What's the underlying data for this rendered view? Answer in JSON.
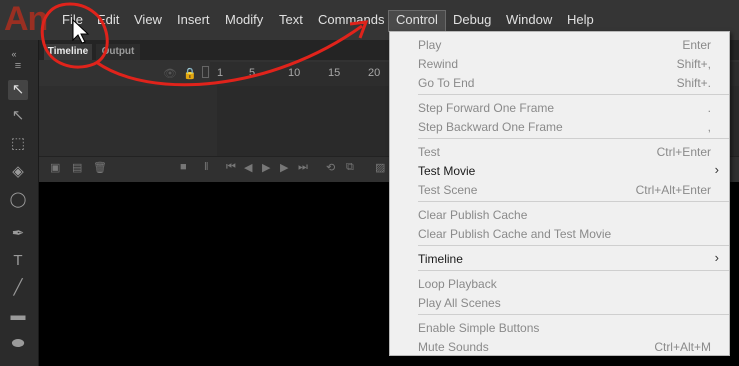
{
  "app": {
    "logo": "An"
  },
  "menubar": {
    "items": [
      "File",
      "Edit",
      "View",
      "Insert",
      "Modify",
      "Text",
      "Commands",
      "Control",
      "Debug",
      "Window",
      "Help"
    ],
    "active": "Control"
  },
  "panel": {
    "tabs": [
      "Timeline",
      "Output"
    ],
    "ruler": [
      "1",
      "5",
      "10",
      "15",
      "20"
    ]
  },
  "control_menu": {
    "items": [
      {
        "label": "Play",
        "shortcut": "Enter",
        "enabled": false
      },
      {
        "label": "Rewind",
        "shortcut": "Shift+,",
        "enabled": false
      },
      {
        "label": "Go To End",
        "shortcut": "Shift+.",
        "enabled": false
      },
      {
        "label": "Step Forward One Frame",
        "shortcut": ".",
        "enabled": false
      },
      {
        "label": "Step Backward One Frame",
        "shortcut": ",",
        "enabled": false
      },
      {
        "label": "Test",
        "shortcut": "Ctrl+Enter",
        "enabled": false
      },
      {
        "label": "Test Movie",
        "shortcut": "",
        "enabled": true,
        "submenu": true
      },
      {
        "label": "Test Scene",
        "shortcut": "Ctrl+Alt+Enter",
        "enabled": false
      },
      {
        "label": "Clear Publish Cache",
        "shortcut": "",
        "enabled": false
      },
      {
        "label": "Clear Publish Cache and Test Movie",
        "shortcut": "",
        "enabled": false
      },
      {
        "label": "Timeline",
        "shortcut": "",
        "enabled": true,
        "submenu": true
      },
      {
        "label": "Loop Playback",
        "shortcut": "",
        "enabled": false
      },
      {
        "label": "Play All Scenes",
        "shortcut": "",
        "enabled": false
      },
      {
        "label": "Enable Simple Buttons",
        "shortcut": "",
        "enabled": false
      },
      {
        "label": "Mute Sounds",
        "shortcut": "Ctrl+Alt+M",
        "enabled": false
      }
    ]
  },
  "colors": {
    "annotation": "#e0231b",
    "menubar": "#353535",
    "menu_bg": "#f0f0f0"
  }
}
